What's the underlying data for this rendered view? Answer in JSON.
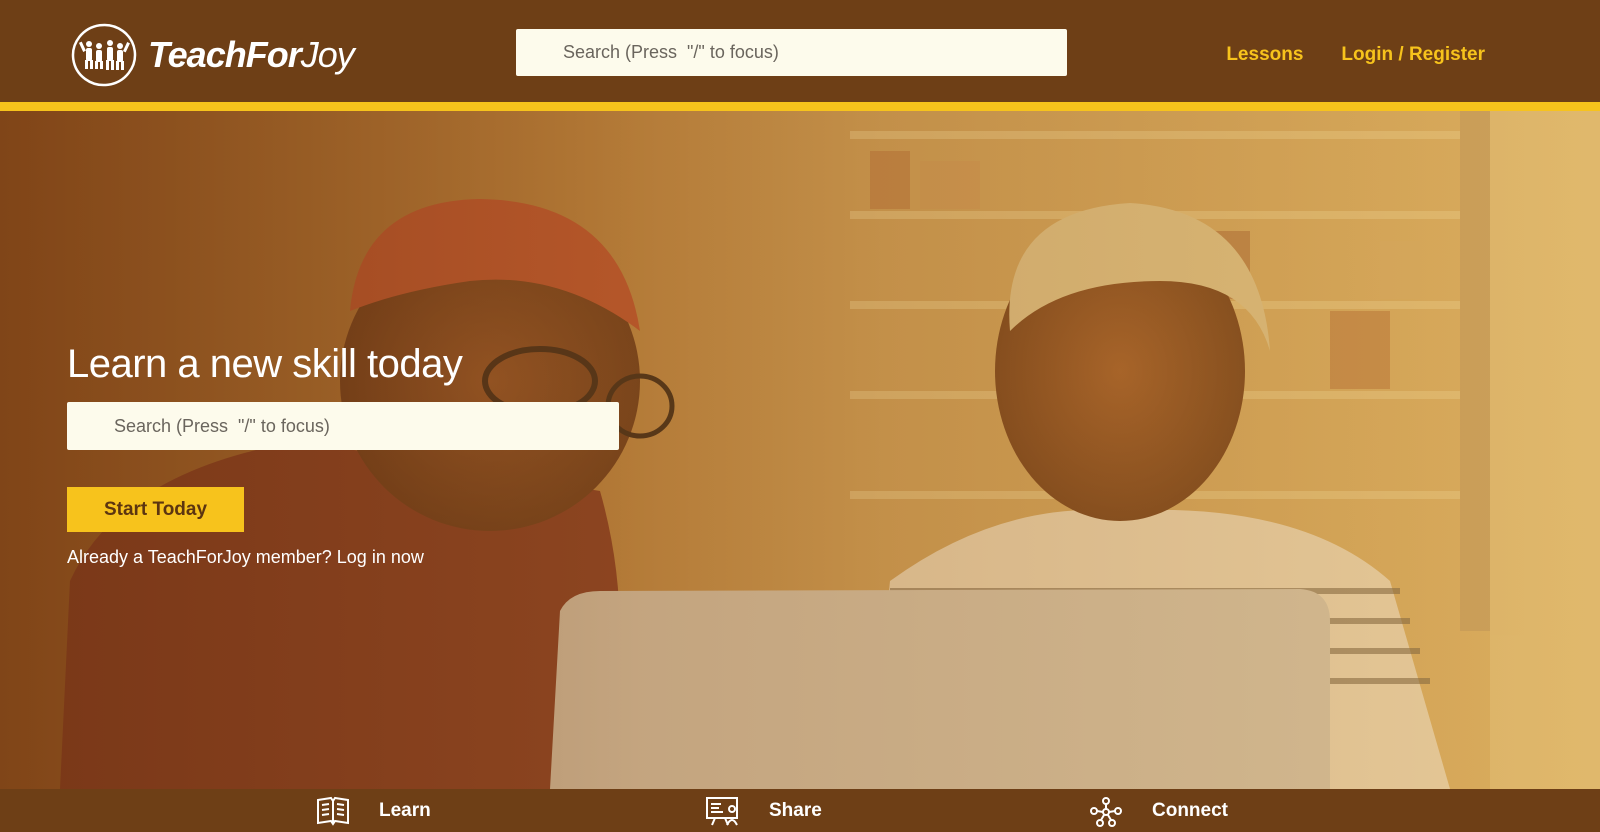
{
  "brand": {
    "name_bold": "TeachFor",
    "name_light": "Joy",
    "logo_icon": "people-jumping-icon"
  },
  "header": {
    "search_placeholder": "Search (Press  \"/\" to focus)",
    "nav": [
      {
        "label": "Lessons"
      },
      {
        "label": "Login / Register"
      }
    ]
  },
  "hero": {
    "title": "Learn a new skill today",
    "search_placeholder": "Search (Press  \"/\" to focus)",
    "cta_label": "Start Today",
    "member_text": "Already a TeachForJoy member? Log in now"
  },
  "features": [
    {
      "label": "Learn",
      "icon": "open-book-icon"
    },
    {
      "label": "Share",
      "icon": "presentation-board-icon"
    },
    {
      "label": "Connect",
      "icon": "network-people-icon"
    }
  ],
  "colors": {
    "header_bg": "#6e3f16",
    "accent": "#f7c31c",
    "search_bg": "#fdfbec"
  }
}
